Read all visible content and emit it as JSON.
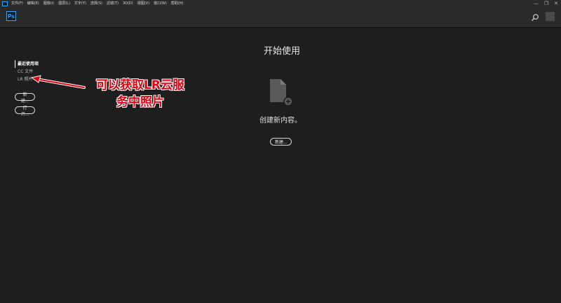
{
  "menubar": {
    "logo_icon": "photoshop-mini-icon",
    "items": [
      "文件(F)",
      "编辑(E)",
      "图像(I)",
      "图层(L)",
      "文字(Y)",
      "选择(S)",
      "滤镜(T)",
      "3D(D)",
      "视图(V)",
      "窗口(W)",
      "帮助(H)"
    ],
    "window_controls": [
      "—",
      "❐",
      "✕"
    ]
  },
  "topbar": {
    "logo_text": "Ps"
  },
  "sidebar": {
    "items": [
      {
        "label": "最近使用项",
        "active": true
      },
      {
        "label": "CC 文件",
        "active": false
      },
      {
        "label": "LR 照片",
        "active": false
      }
    ],
    "new_button": "新建...",
    "open_button": "打开..."
  },
  "annotation": {
    "line1": "可以获取LR云服",
    "line2": "务中照片",
    "color": "#e60012"
  },
  "main": {
    "title": "开始使用",
    "create_text": "创建新内容。",
    "new_button": "新建..."
  },
  "colors": {
    "background": "#1e1e1e",
    "topbar": "#2a2a2a",
    "accent": "#31a8ff"
  }
}
